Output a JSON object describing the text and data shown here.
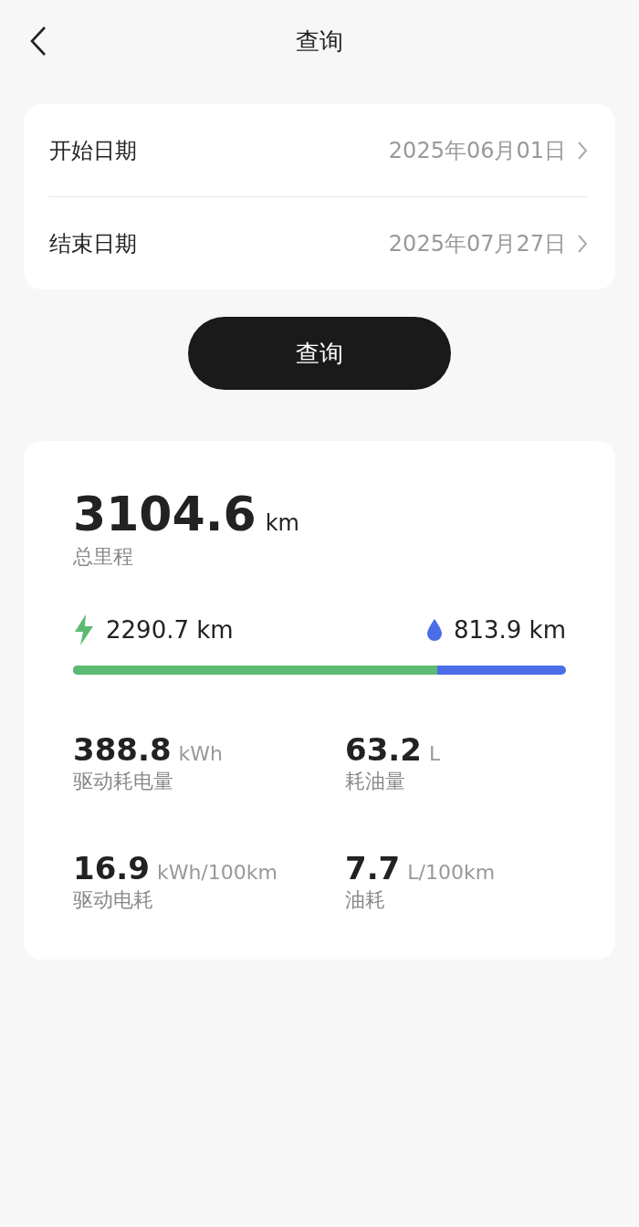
{
  "header": {
    "title": "查询"
  },
  "date_fields": [
    {
      "label": "开始日期",
      "value": "2025年06月01日"
    },
    {
      "label": "结束日期",
      "value": "2025年07月27日"
    }
  ],
  "query_button": "查询",
  "summary": {
    "total": "3104.6",
    "total_unit": "km",
    "total_label": "总里程",
    "electric": {
      "value": "2290.7",
      "unit": "km"
    },
    "fuel": {
      "value": "813.9",
      "unit": "km"
    },
    "level": 0.738,
    "stats": [
      {
        "value": "388.8",
        "unit": "kWh",
        "label": "驱动耗电量"
      },
      {
        "value": "63.2",
        "unit": "L",
        "label": "耗油量"
      },
      {
        "value": "16.9",
        "unit": "kWh/100km",
        "label": "驱动电耗"
      },
      {
        "value": "7.7",
        "unit": "L/100km",
        "label": "油耗"
      }
    ]
  }
}
